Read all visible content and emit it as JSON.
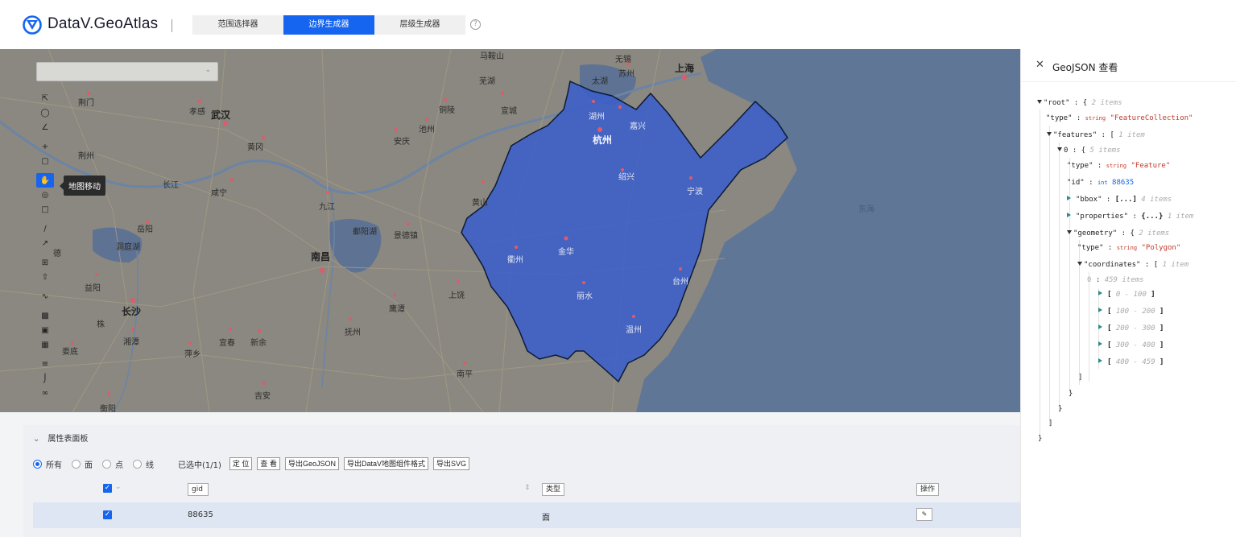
{
  "header": {
    "logo_icon": "datav-logo-icon",
    "brand": "DataV.GeoAtlas",
    "tabs": [
      {
        "label": "范围选择器",
        "active": false
      },
      {
        "label": "边界生成器",
        "active": true
      },
      {
        "label": "层级生成器",
        "active": false
      }
    ],
    "help_icon": "question-circle-icon"
  },
  "map": {
    "labels": {
      "wuhan": "武汉",
      "nanchang": "南昌",
      "changsha": "长沙",
      "hangzhou": "杭州",
      "shanghai": "上海",
      "jingmen": "荆门",
      "xiaogan": "孝感",
      "huanggang": "黄冈",
      "jingzhou": "荆州",
      "xianning": "咸宁",
      "changjiang": "长江",
      "jiujiang": "九江",
      "yueyang": "岳阳",
      "dongtinghu": "洞庭湖",
      "yiyang": "益阳",
      "xiangtan": "湘潭",
      "loudi": "娄底",
      "pingxiang": "萍乡",
      "yichun": "宜春",
      "xinyu": "新余",
      "fuzhou": "抚州",
      "jian": "吉安",
      "poyanghu": "鄱阳湖",
      "jingdezhen": "景德镇",
      "yingtan": "鹰潭",
      "shangrao": "上饶",
      "huangshan": "黄山",
      "anqing": "安庆",
      "chizhou": "池州",
      "tongling": "铜陵",
      "xuancheng": "宣城",
      "wuhu": "芜湖",
      "maanshan": "马鞍山",
      "wuxi": "无锡",
      "suzhou": "苏州",
      "huzhou": "湖州",
      "jiaxing": "嘉兴",
      "shaoxing": "绍兴",
      "ningbo": "宁波",
      "jinhua": "金华",
      "quzhou": "衢州",
      "lishui": "丽水",
      "taizhou": "台州",
      "wenzhou": "温州",
      "nanping": "南平",
      "donghai": "东海",
      "hengyang": "衡阳",
      "taihu": "太湖",
      "zhu": "株",
      "de": "德"
    },
    "select_value": "",
    "tools": [
      "select-box-icon",
      "select-circle-icon",
      "select-polygon-icon",
      "zoom-in-icon",
      "fit-view-icon",
      "pan-hand-icon",
      "drag-point-icon",
      "polygon-tool-icon",
      "line-tool-icon",
      "ruler-icon",
      "measure-icon",
      "import-icon",
      "export-icon",
      "chart-line-icon",
      "union-icon",
      "intersect-icon",
      "difference-icon",
      "split-icon",
      "crop-icon",
      "link-icon"
    ],
    "tooltip": "地图移动"
  },
  "attr_panel": {
    "title": "属性表面板",
    "filters": [
      {
        "label": "所有",
        "checked": true
      },
      {
        "label": "面",
        "checked": false
      },
      {
        "label": "点",
        "checked": false
      },
      {
        "label": "线",
        "checked": false
      }
    ],
    "selected_count": "已选中(1/1)",
    "buttons": [
      "定 位",
      "查 看",
      "导出GeoJSON",
      "导出DataV地图组件格式",
      "导出SVG"
    ],
    "columns": {
      "id": "gid",
      "type": "类型",
      "action": "操作"
    },
    "rows": [
      {
        "gid": "88635",
        "type": "面",
        "action_icon": "edit-icon"
      }
    ]
  },
  "geojson_panel": {
    "title": "GeoJSON 查看",
    "close_icon": "close-icon",
    "lines": {
      "l1_key": "\"root\"",
      "l1_sep": " : ",
      "l1_open": "{",
      "l1_count": "2 items",
      "l2_key": "\"type\"",
      "l2_sep": " : ",
      "l2_type": "string",
      "l2_val": "\"FeatureCollection\"",
      "l3_key": "\"features\"",
      "l3_sep": " : ",
      "l3_open": "[",
      "l3_count": "1 item",
      "l4_key": "0",
      "l4_sep": " : ",
      "l4_open": "{",
      "l4_count": "5 items",
      "l5_key": "\"type\"",
      "l5_sep": " : ",
      "l5_type": "string",
      "l5_val": "\"Feature\"",
      "l6_key": "\"id\"",
      "l6_sep": " : ",
      "l6_type": "int",
      "l6_val": "88635",
      "l7_key": "\"bbox\"",
      "l7_sep": " : ",
      "l7_val": "[...]",
      "l7_count": "4 items",
      "l8_key": "\"properties\"",
      "l8_sep": " : ",
      "l8_val": "{...}",
      "l8_count": "1 item",
      "l9_key": "\"geometry\"",
      "l9_sep": " : ",
      "l9_open": "{",
      "l9_count": "2 items",
      "l10_key": "\"type\"",
      "l10_sep": " : ",
      "l10_type": "string",
      "l10_val": "\"Polygon\"",
      "l11_key": "\"coordinates\"",
      "l11_sep": " : ",
      "l11_open": "[",
      "l11_count": "1 item",
      "l12_key": "0",
      "l12_sep": " : ",
      "l12_count": "459 items",
      "ranges": [
        "0 - 100",
        "100 - 200",
        "200 - 300",
        "300 - 400",
        "400 - 459"
      ],
      "close_bracket": "]",
      "close_brace": "}"
    }
  }
}
